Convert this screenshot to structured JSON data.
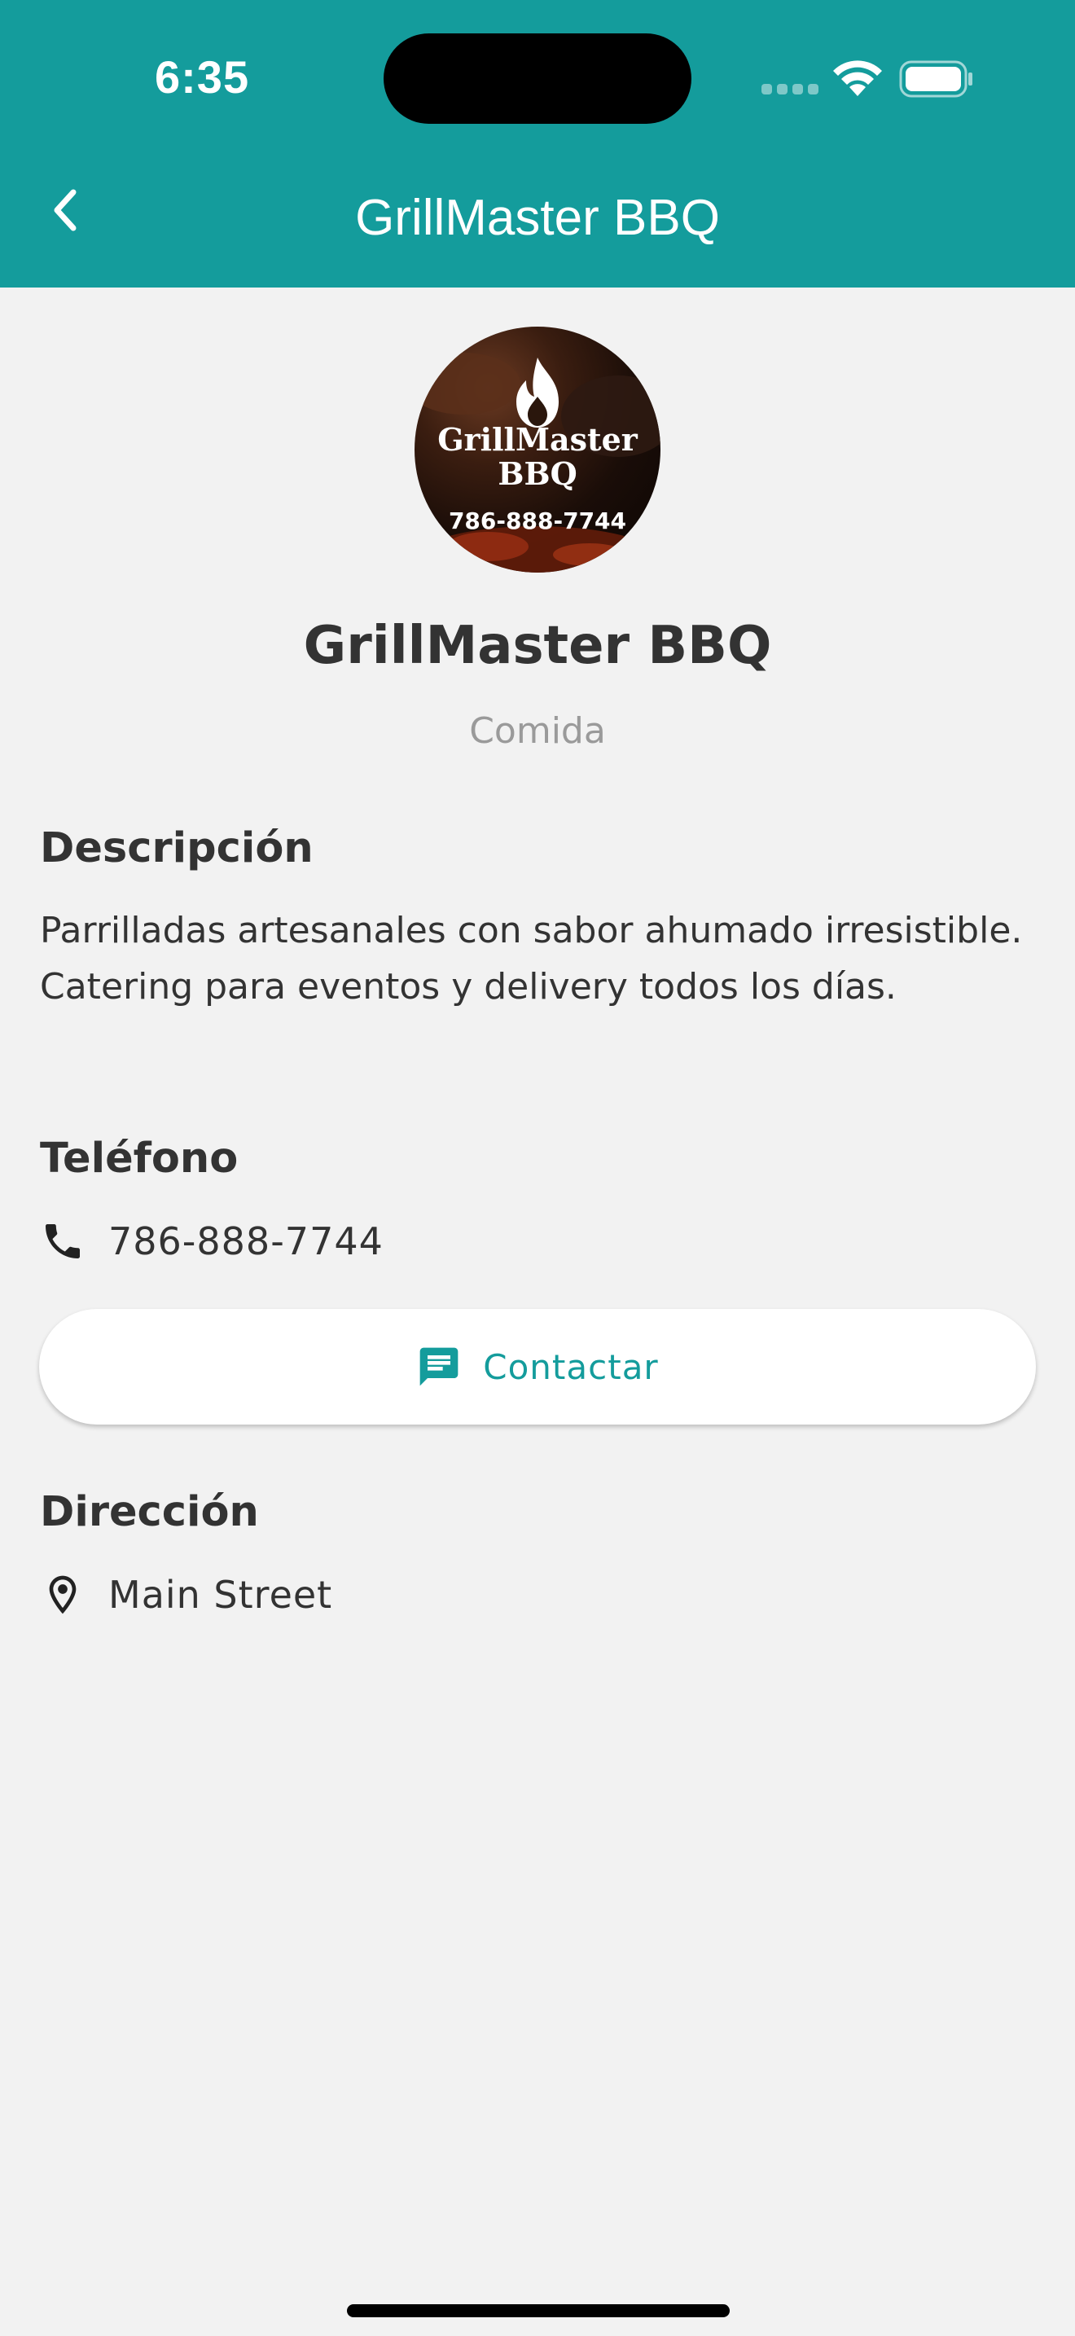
{
  "status_bar": {
    "time": "6:35"
  },
  "app_bar": {
    "title": "GrillMaster BBQ",
    "background_color": "#149c9c"
  },
  "business": {
    "logo": {
      "name_line1": "GrillMaster",
      "name_line2": "BBQ",
      "phone": "786-888-7744"
    },
    "name": "GrillMaster BBQ",
    "category": "Comida"
  },
  "description": {
    "heading": "Descripción",
    "text": "Parrilladas artesanales con sabor ahumado irresistible. Catering para eventos y delivery todos los días."
  },
  "phone": {
    "heading": "Teléfono",
    "icon": "phone-icon",
    "value": "786-888-7744"
  },
  "contact_button": {
    "icon": "message-icon",
    "label": "Contactar",
    "accent_color": "#149c9c"
  },
  "address": {
    "heading": "Dirección",
    "icon": "location-pin-icon",
    "value": "Main Street"
  }
}
